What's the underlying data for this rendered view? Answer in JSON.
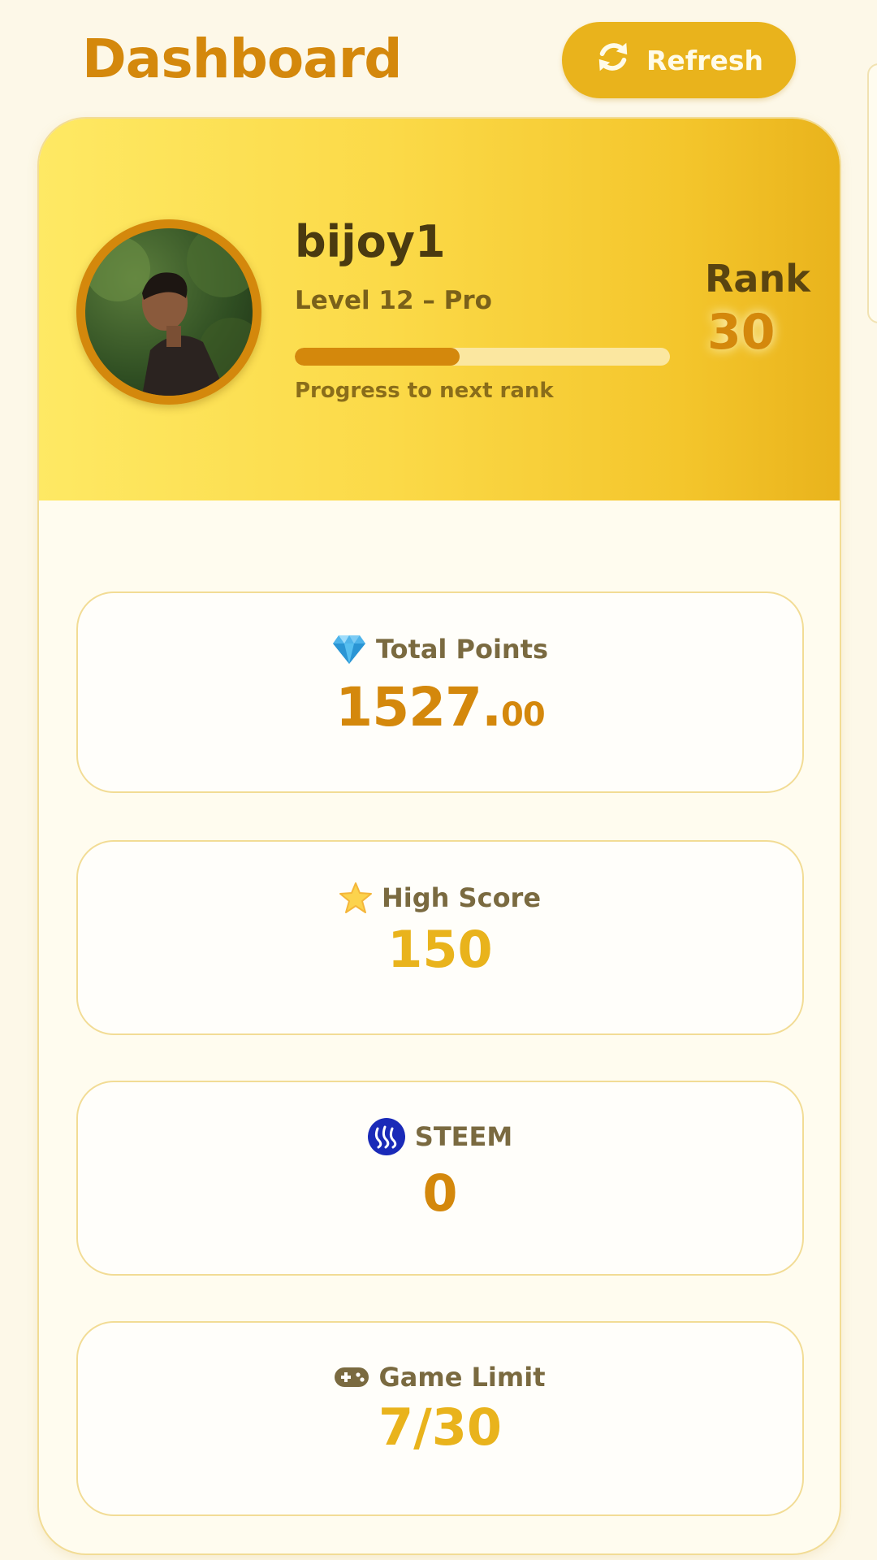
{
  "page": {
    "title": "Dashboard"
  },
  "refresh": {
    "label": "Refresh",
    "icon": "refresh-icon"
  },
  "profile": {
    "username": "bijoy1",
    "level": "Level 12 – Pro",
    "progress": 0.44,
    "progress_label": "Progress to next rank",
    "rank_label": "Rank",
    "rank_value": "30"
  },
  "stats": {
    "total_points": {
      "icon": "diamond-icon",
      "label": "Total Points",
      "value_int": "1527.",
      "value_dec": "00"
    },
    "high_score": {
      "icon": "star-icon",
      "label": "High Score",
      "value": "150"
    },
    "steem": {
      "icon": "steem-icon",
      "label": "STEEM",
      "value": "0"
    },
    "game_limit": {
      "icon": "gamepad-icon",
      "label": "Game Limit",
      "value": "7/30"
    }
  },
  "colors": {
    "accent": "#d4880c",
    "gold": "#e9b31c",
    "header_gradient_start": "#fee964",
    "header_gradient_end": "#e9b31c",
    "background": "#fdf8e8"
  }
}
